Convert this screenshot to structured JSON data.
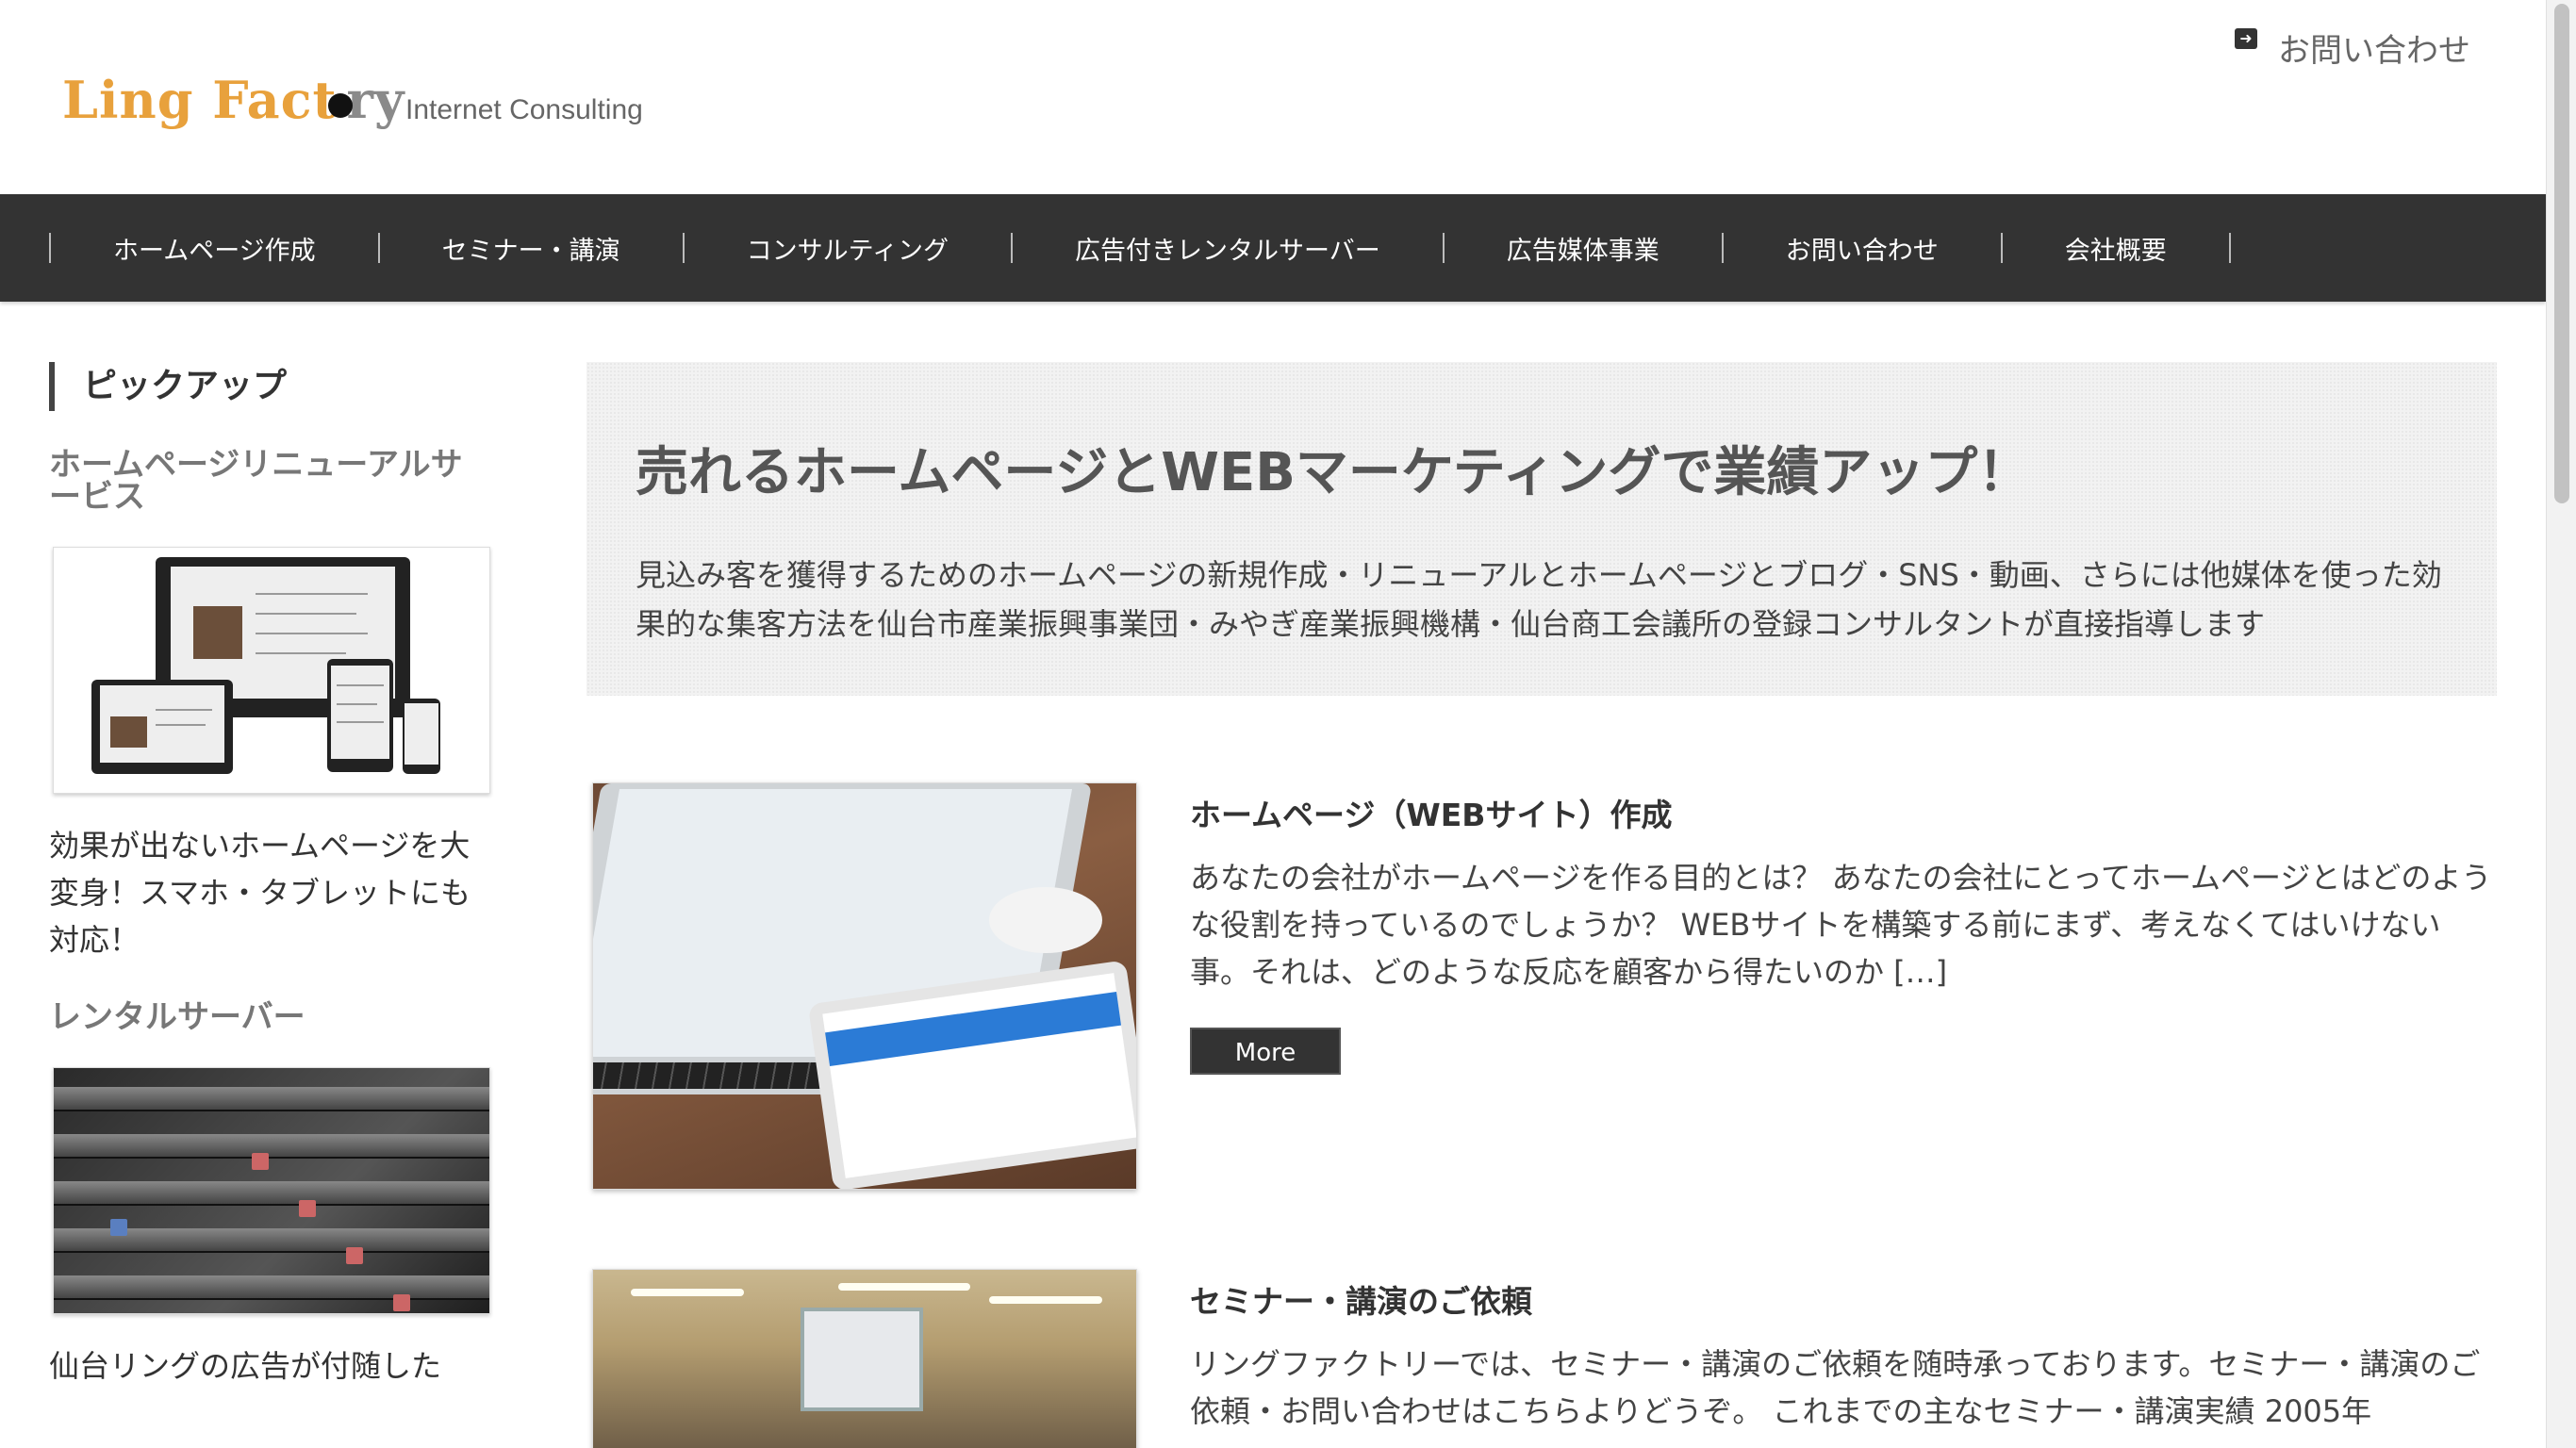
{
  "header": {
    "logo_text": "Ling Factory",
    "logo_part1": "Ling Fact",
    "logo_part2": "ry",
    "tagline": "Internet Consulting",
    "contact_label": "お問い合わせ"
  },
  "nav": {
    "items": [
      {
        "label": "ホームページ作成"
      },
      {
        "label": "セミナー・講演"
      },
      {
        "label": "コンサルティング"
      },
      {
        "label": "広告付きレンタルサーバー"
      },
      {
        "label": "広告媒体事業"
      },
      {
        "label": "お問い合わせ"
      },
      {
        "label": "会社概要"
      }
    ]
  },
  "sidebar": {
    "title": "ピックアップ",
    "items": [
      {
        "heading": "ホームページリニューアルサービス",
        "image": "responsive-devices-image",
        "text": "効果が出ないホームページを大変身！スマホ・タブレットにも対応！"
      },
      {
        "heading": "レンタルサーバー",
        "image": "server-rack-image",
        "text": "仙台リングの広告が付随した"
      }
    ]
  },
  "hero": {
    "title": "売れるホームページとWEBマーケティングで業績アップ！",
    "text": "見込み客を獲得するためのホームページの新規作成・リニューアルとホームページとブログ・SNS・動画、さらには他媒体を使った効果的な集客方法を仙台市産業振興事業団・みやぎ産業振興機構・仙台商工会議所の登録コンサルタントが直接指導します"
  },
  "articles": [
    {
      "title": "ホームページ（WEBサイト）作成",
      "text": "あなたの会社がホームページを作る目的とは？ あなたの会社にとってホームページとはどのような役割を持っているのでしょうか？ WEBサイトを構築する前にまず、考えなくてはいけない事。それは、どのような反応を顧客から得たいのか […]",
      "more_label": "More",
      "image": "laptop-tablet-image"
    },
    {
      "title": "セミナー・講演のご依頼",
      "text": "リングファクトリーでは、セミナー・講演のご依頼を随時承っております。セミナー・講演のご依頼・お問い合わせはこちらよりどうぞ。 これまでの主なセミナー・講演実績 2005年",
      "image": "seminar-room-image"
    }
  ],
  "colors": {
    "nav_bg": "#333333",
    "logo_orange": "#e8a13c",
    "logo_gray": "#8a8a8a",
    "hero_bg": "#f2f2f2",
    "button_bg": "#333333"
  }
}
